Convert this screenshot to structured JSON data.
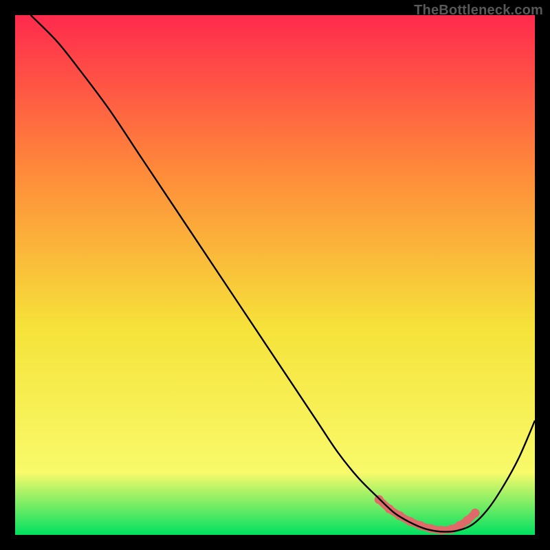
{
  "watermark": "TheBottleneck.com",
  "chart_data": {
    "type": "line",
    "title": "",
    "xlabel": "",
    "ylabel": "",
    "xlim": [
      0,
      100
    ],
    "ylim": [
      0,
      100
    ],
    "grid": false,
    "legend": false,
    "gradient_colors": {
      "top": "#ff2a4d",
      "upper_mid": "#ff8a3a",
      "mid": "#f6e23a",
      "lower_mid": "#f8fa6a",
      "bottom": "#00e060"
    },
    "series": [
      {
        "name": "curve",
        "color": "#000000",
        "x": [
          3,
          8,
          12,
          18,
          24,
          30,
          36,
          42,
          48,
          54,
          58,
          62,
          66,
          70,
          73,
          76,
          78.5,
          80.5,
          82.5,
          85,
          88,
          91,
          94,
          97,
          100
        ],
        "y": [
          100,
          95,
          90,
          82,
          73,
          64,
          55,
          46,
          37,
          28,
          22,
          16,
          11,
          7,
          4.2,
          2.4,
          1.3,
          0.8,
          0.6,
          0.8,
          2.0,
          5.0,
          9.5,
          15,
          22
        ]
      },
      {
        "name": "highlight",
        "color": "#e06a6a",
        "marker": "dot",
        "x": [
          70,
          72,
          74,
          76,
          78,
          80,
          82,
          84,
          85.5,
          87,
          88.5
        ],
        "y": [
          6.8,
          5.0,
          3.7,
          2.6,
          1.8,
          1.2,
          0.9,
          1.1,
          1.8,
          2.8,
          4.2
        ]
      }
    ]
  }
}
